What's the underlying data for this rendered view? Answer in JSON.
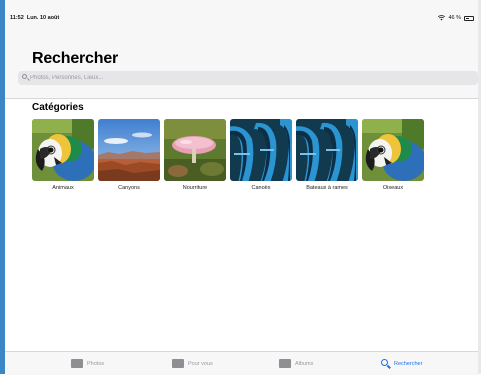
{
  "status_bar": {
    "time": "11:52",
    "date": "Lun. 10 août",
    "battery": "46 %"
  },
  "header": {
    "title": "Rechercher"
  },
  "search": {
    "placeholder": "Photos, Personnes, Lieux..."
  },
  "categories": {
    "title": "Catégories",
    "items": [
      {
        "label": "Animaux"
      },
      {
        "label": "Canyons"
      },
      {
        "label": "Nourriture"
      },
      {
        "label": "Canoës"
      },
      {
        "label": "Bateaux à rames"
      },
      {
        "label": "Oiseaux"
      }
    ]
  },
  "tab_bar": {
    "tabs": [
      {
        "label": "Photos",
        "icon": "photos-icon"
      },
      {
        "label": "Pour vous",
        "icon": "for-you-icon"
      },
      {
        "label": "Albums",
        "icon": "albums-icon"
      },
      {
        "label": "Rechercher",
        "icon": "search-icon",
        "active": true
      }
    ]
  },
  "colors": {
    "accent": "#1a73e8",
    "bar_background": "#f7f7f8"
  }
}
